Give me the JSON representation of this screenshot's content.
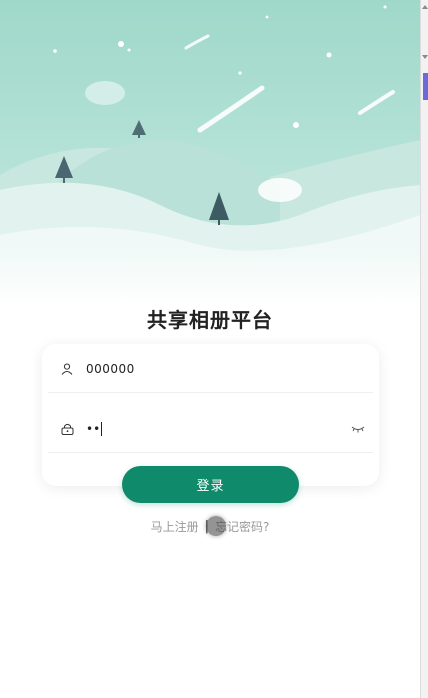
{
  "app": {
    "title": "共享相册平台"
  },
  "login_form": {
    "username_value": "000000",
    "password_mask": "••",
    "login_label": "登录"
  },
  "links": {
    "register_label": "马上注册",
    "separator": "|",
    "forgot_label": "忘记密码?"
  },
  "icons": {
    "user": "user-icon",
    "lock": "lock-icon",
    "eye": "eye-closed-icon"
  },
  "colors": {
    "primary": "#0f8a6a",
    "hero_sky": "#a9dccf",
    "hero_hills": "#d9eeea",
    "text_muted": "#999999",
    "scrollbar_thumb": "#6a6ad8"
  }
}
